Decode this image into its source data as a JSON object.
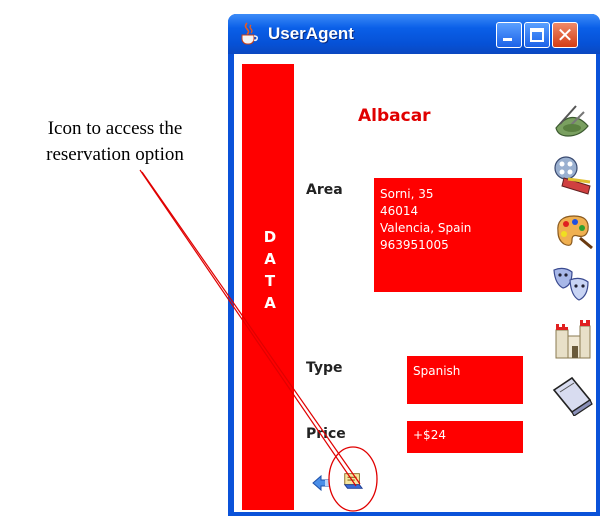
{
  "annotation": {
    "caption_line1": "Icon to access the",
    "caption_line2": "reservation option"
  },
  "window": {
    "title": "UserAgent",
    "buttons": {
      "minimize": "_",
      "maximize": "□",
      "close": "✕"
    }
  },
  "sidebar_label": [
    "D",
    "A",
    "T",
    "A"
  ],
  "restaurant": {
    "name": "Albacar",
    "area_label": "Area",
    "address_lines": [
      "Sorni, 35",
      "46014",
      "Valencia, Spain",
      "963951005"
    ],
    "type_label": "Type",
    "type_value": "Spanish",
    "price_label": "Price",
    "price_value": "+$24"
  },
  "bottom_icons": [
    "back-arrow-icon",
    "reservation-icon"
  ],
  "side_icons": [
    "restaurant-food-icon",
    "cinema-film-icon",
    "art-palette-icon",
    "theatre-masks-icon",
    "castle-monument-icon",
    "book-icon"
  ],
  "colors": {
    "accent_red": "#ff0000",
    "title_blue": "#0a52d9",
    "name_red": "#e00000"
  }
}
